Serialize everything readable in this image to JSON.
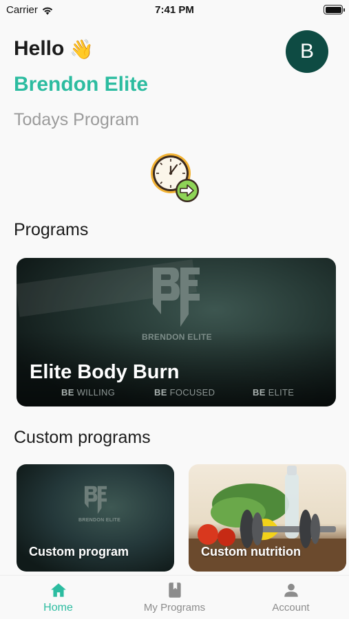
{
  "status_bar": {
    "carrier": "Carrier",
    "time": "7:41 PM"
  },
  "header": {
    "greeting": "Hello",
    "wave_icon": "👋",
    "user_name": "Brendon Elite",
    "today_label": "Todays Program",
    "avatar_initial": "B"
  },
  "sections": {
    "programs_title": "Programs",
    "custom_title": "Custom programs"
  },
  "program_card": {
    "brand": "BRENDON ELITE",
    "logo_text": "BE",
    "title": "Elite Body Burn",
    "motto": [
      {
        "prefix": "BE",
        "word": "WILLING"
      },
      {
        "prefix": "BE",
        "word": "FOCUSED"
      },
      {
        "prefix": "BE",
        "word": "ELITE"
      }
    ]
  },
  "custom_cards": [
    {
      "label": "Custom program",
      "brand": "BRENDON ELITE",
      "logo_text": "BE"
    },
    {
      "label": "Custom nutrition"
    }
  ],
  "nav": {
    "items": [
      {
        "label": "Home",
        "icon": "home-icon",
        "active": true
      },
      {
        "label": "My Programs",
        "icon": "book-icon",
        "active": false
      },
      {
        "label": "Account",
        "icon": "person-icon",
        "active": false
      }
    ]
  },
  "colors": {
    "accent": "#2cbca0",
    "avatar_bg": "#0e4b43"
  }
}
